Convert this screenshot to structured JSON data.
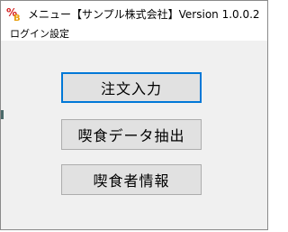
{
  "window": {
    "title": "メニュー【サンプル株式会社】Version 1.0.0.2",
    "app_icon": "app-logo-icon"
  },
  "menubar": {
    "items": [
      {
        "label": "ログイン設定"
      }
    ]
  },
  "buttons": [
    {
      "label": "注文入力",
      "focused": true
    },
    {
      "label": "喫食データ抽出",
      "focused": false
    },
    {
      "label": "喫食者情報",
      "focused": false
    }
  ],
  "colors": {
    "focus_border": "#0078d7",
    "button_bg": "#e1e1e1",
    "client_bg": "#f0f0f0"
  }
}
